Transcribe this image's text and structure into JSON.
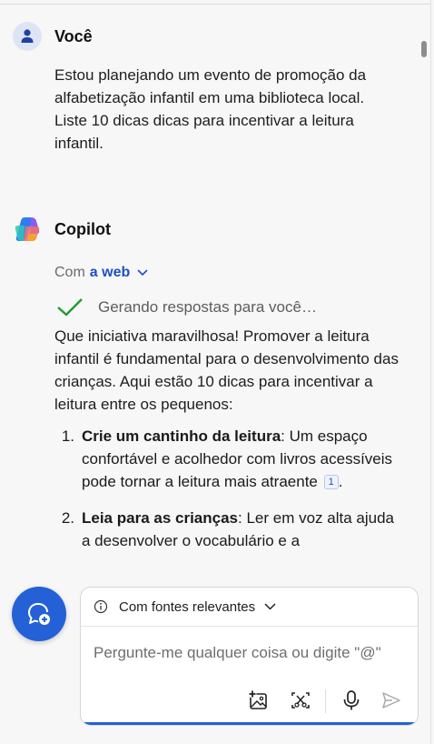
{
  "user_message": {
    "author": "Você",
    "text": "Estou planejando um evento de promoção da alfabetização infantil em uma biblioteca local. Liste 10 dicas dicas para incentivar a leitura infantil."
  },
  "copilot_message": {
    "author": "Copilot",
    "source_prefix": "Com",
    "source_link": "a web",
    "generating_label": "Gerando respostas para você…",
    "intro": "Que iniciativa maravilhosa! Promover a leitura infantil é fundamental para o desenvolvimento das crianças. Aqui estão 10 dicas para incentivar a leitura entre os pequenos:",
    "tips": [
      {
        "num": "1.",
        "title": "Crie um cantinho da leitura",
        "text": ": Um espaço confortável e acolhedor com livros acessíveis pode tornar a leitura mais atraente",
        "cite": "1",
        "end": "."
      },
      {
        "num": "2.",
        "title": "Leia para as crianças",
        "text": ": Ler em voz alta ajuda a desenvolver o vocabulário e a",
        "cite": "",
        "end": ""
      }
    ]
  },
  "composer": {
    "options_label": "Com fontes relevantes",
    "placeholder": "Pergunte-me qualquer coisa ou digite \"@\""
  },
  "colors": {
    "accent": "#2461d6",
    "link": "#1e4fc7",
    "check": "#1f9d2f"
  }
}
